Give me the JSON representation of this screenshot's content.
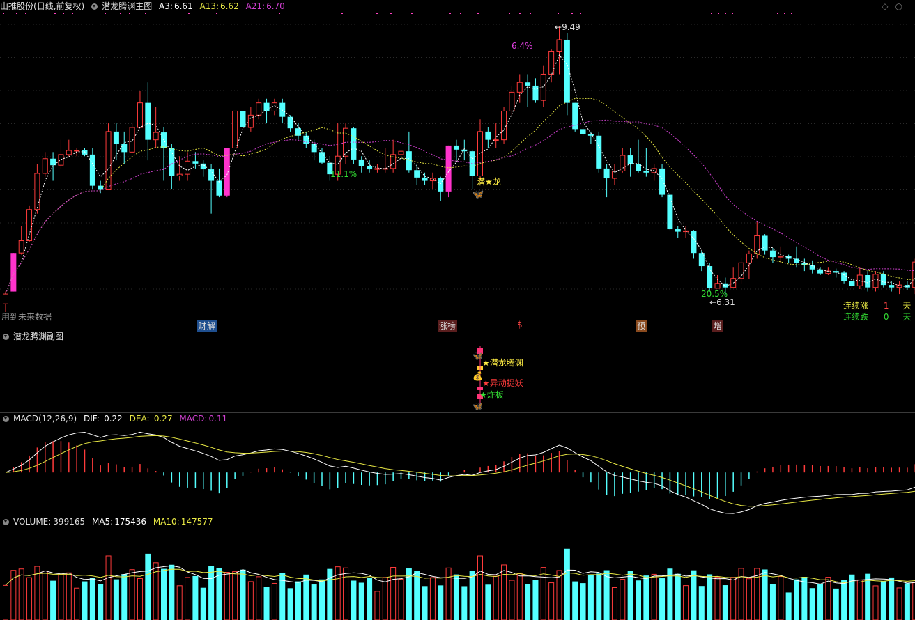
{
  "main": {
    "stock": "山推股份",
    "period": "(日线,前复权)",
    "indicator": "潜龙腾渊主图",
    "a3_label": "A3:",
    "a3": "6.61",
    "a13_label": "A13:",
    "a13": "6.62",
    "a21_label": "A21:",
    "a21": "6.70",
    "future_data": "用到未来数据",
    "high_label": "9.49",
    "low_label": "6.31",
    "pct_labels": [
      "6.4%",
      "11.1%",
      "20.5%"
    ],
    "signal": "潜★龙",
    "events": [
      "财",
      "解",
      "涨榜",
      "$",
      "预",
      "增"
    ],
    "streak_up_label": "连续涨",
    "streak_up": "1",
    "streak_up_unit": "天",
    "streak_down_label": "连续跌",
    "streak_down": "0",
    "streak_down_unit": "天"
  },
  "sub": {
    "title": "潜龙腾渊副图",
    "signals": [
      "★潜龙腾渊",
      "★异动捉妖",
      "★炸板"
    ]
  },
  "macd": {
    "title": "MACD(12,26,9)",
    "dif_label": "DIF:",
    "dif": "-0.22",
    "dea_label": "DEA:",
    "dea": "-0.27",
    "macd_label": "MACD:",
    "macd": "0.11"
  },
  "volume": {
    "title": "VOLUME:",
    "value": "399165",
    "ma5_label": "MA5:",
    "ma5": "175436",
    "ma10_label": "MA10:",
    "ma10": "147577"
  },
  "colors": {
    "up": "#ff3b3b",
    "down": "#54ffff",
    "ma_white": "#ffffff",
    "ma_yellow": "#e8e844",
    "ma_purple": "#d040d0",
    "limit_up": "#ff33cc"
  },
  "chart_data": {
    "type": "candlestick",
    "ylim": [
      6.0,
      9.6
    ],
    "candles": [
      [
        6.1,
        6.22,
        6.0,
        6.25
      ],
      [
        6.25,
        6.72,
        6.25,
        6.72
      ],
      [
        6.72,
        6.87,
        6.7,
        7.05
      ],
      [
        6.87,
        7.25,
        6.85,
        7.3
      ],
      [
        7.25,
        7.69,
        7.2,
        7.8
      ],
      [
        7.69,
        7.87,
        7.65,
        7.95
      ],
      [
        7.87,
        7.79,
        7.6,
        7.95
      ],
      [
        7.79,
        7.92,
        7.75,
        8.1
      ],
      [
        7.92,
        7.97,
        7.9,
        8.1
      ],
      [
        7.97,
        7.97,
        7.9,
        8.0
      ],
      [
        7.97,
        7.92,
        7.9,
        8.0
      ],
      [
        7.92,
        7.54,
        7.5,
        8.0
      ],
      [
        7.54,
        7.49,
        7.45,
        7.6
      ],
      [
        7.49,
        8.2,
        7.5,
        8.3
      ],
      [
        8.2,
        8.05,
        7.85,
        8.3
      ],
      [
        8.05,
        7.95,
        7.8,
        8.2
      ],
      [
        7.95,
        8.25,
        7.95,
        8.3
      ],
      [
        8.25,
        8.55,
        8.25,
        8.7
      ],
      [
        8.55,
        8.1,
        7.85,
        8.8
      ],
      [
        8.1,
        8.19,
        8.0,
        8.5
      ],
      [
        8.19,
        8.0,
        7.6,
        8.25
      ],
      [
        8.0,
        7.66,
        7.5,
        8.05
      ],
      [
        7.66,
        7.68,
        7.6,
        7.9
      ],
      [
        7.68,
        7.84,
        7.6,
        7.95
      ],
      [
        7.84,
        7.81,
        7.75,
        7.95
      ],
      [
        7.81,
        7.74,
        7.65,
        7.85
      ],
      [
        7.74,
        7.6,
        7.2,
        7.8
      ],
      [
        7.6,
        7.42,
        7.4,
        7.75
      ],
      [
        7.42,
        8.0,
        7.4,
        8.0
      ],
      [
        8.0,
        8.45,
        8.0,
        8.45
      ],
      [
        8.45,
        8.25,
        8.2,
        8.5
      ],
      [
        8.25,
        8.4,
        8.2,
        8.5
      ],
      [
        8.4,
        8.55,
        8.35,
        8.6
      ],
      [
        8.55,
        8.45,
        8.3,
        8.6
      ],
      [
        8.45,
        8.55,
        8.4,
        8.6
      ],
      [
        8.55,
        8.38,
        8.3,
        8.6
      ],
      [
        8.38,
        8.24,
        8.2,
        8.4
      ],
      [
        8.24,
        8.15,
        8.1,
        8.3
      ],
      [
        8.15,
        8.05,
        8.0,
        8.2
      ],
      [
        8.05,
        7.95,
        7.85,
        8.1
      ],
      [
        7.95,
        7.82,
        7.8,
        8.0
      ],
      [
        7.82,
        7.68,
        7.6,
        7.9
      ],
      [
        7.68,
        7.9,
        7.6,
        8.3
      ],
      [
        7.9,
        8.24,
        7.8,
        8.3
      ],
      [
        8.24,
        7.86,
        7.8,
        8.25
      ],
      [
        7.86,
        7.78,
        7.7,
        7.9
      ],
      [
        7.78,
        7.74,
        7.7,
        7.85
      ],
      [
        7.74,
        7.75,
        7.7,
        7.8
      ],
      [
        7.75,
        7.75,
        7.7,
        8.0
      ],
      [
        7.75,
        7.92,
        7.7,
        8.1
      ],
      [
        7.92,
        7.96,
        7.75,
        8.15
      ],
      [
        7.96,
        7.73,
        7.7,
        8.2
      ],
      [
        7.73,
        7.64,
        7.55,
        7.8
      ],
      [
        7.64,
        7.6,
        7.55,
        7.7
      ],
      [
        7.6,
        7.63,
        7.5,
        7.7
      ],
      [
        7.63,
        7.47,
        7.35,
        7.65
      ],
      [
        7.47,
        8.03,
        7.4,
        8.03
      ],
      [
        8.03,
        7.98,
        7.85,
        8.1
      ],
      [
        7.98,
        7.96,
        7.85,
        8.1
      ],
      [
        7.96,
        7.66,
        7.5,
        7.98
      ],
      [
        7.66,
        8.2,
        7.6,
        8.35
      ],
      [
        8.2,
        8.1,
        8.0,
        8.25
      ],
      [
        8.1,
        8.1,
        8.0,
        8.3
      ],
      [
        8.1,
        8.45,
        8.05,
        8.5
      ],
      [
        8.45,
        8.68,
        8.4,
        8.75
      ],
      [
        8.68,
        8.8,
        8.55,
        8.9
      ],
      [
        8.8,
        8.76,
        8.5,
        8.9
      ],
      [
        8.76,
        8.58,
        8.55,
        8.85
      ],
      [
        8.58,
        8.9,
        8.5,
        9.0
      ],
      [
        8.9,
        9.18,
        8.8,
        9.2
      ],
      [
        9.18,
        9.32,
        8.9,
        9.49
      ],
      [
        9.32,
        8.55,
        8.4,
        9.4
      ],
      [
        8.55,
        8.23,
        8.2,
        8.55
      ],
      [
        8.23,
        8.17,
        8.15,
        8.25
      ],
      [
        8.17,
        8.15,
        8.05,
        8.2
      ],
      [
        8.15,
        7.75,
        7.7,
        8.2
      ],
      [
        7.75,
        7.63,
        7.4,
        7.8
      ],
      [
        7.63,
        7.72,
        7.55,
        7.8
      ],
      [
        7.72,
        7.91,
        7.7,
        8.0
      ],
      [
        7.91,
        7.8,
        7.65,
        8.0
      ],
      [
        7.8,
        7.72,
        7.7,
        8.1
      ],
      [
        7.72,
        7.7,
        7.65,
        8.0
      ],
      [
        7.7,
        7.75,
        7.6,
        7.8
      ],
      [
        7.75,
        7.43,
        7.4,
        7.8
      ],
      [
        7.43,
        7.01,
        7.0,
        7.45
      ],
      [
        7.01,
        6.98,
        6.9,
        7.05
      ],
      [
        6.98,
        6.99,
        6.9,
        7.05
      ],
      [
        6.99,
        6.72,
        6.65,
        7.0
      ],
      [
        6.72,
        6.56,
        6.5,
        6.75
      ],
      [
        6.56,
        6.29,
        6.25,
        6.6
      ],
      [
        6.29,
        6.35,
        6.31,
        6.45
      ],
      [
        6.35,
        6.3,
        6.2,
        6.42
      ],
      [
        6.3,
        6.41,
        6.3,
        6.55
      ],
      [
        6.41,
        6.6,
        6.35,
        6.66
      ],
      [
        6.6,
        6.71,
        6.4,
        6.75
      ],
      [
        6.71,
        6.93,
        6.65,
        7.1
      ],
      [
        6.93,
        6.75,
        6.7,
        6.95
      ],
      [
        6.75,
        6.67,
        6.6,
        6.78
      ],
      [
        6.67,
        6.68,
        6.6,
        6.8
      ],
      [
        6.68,
        6.65,
        6.6,
        6.7
      ],
      [
        6.65,
        6.6,
        6.55,
        6.8
      ],
      [
        6.6,
        6.57,
        6.5,
        6.65
      ],
      [
        6.57,
        6.52,
        6.47,
        6.63
      ],
      [
        6.52,
        6.47,
        6.45,
        6.55
      ],
      [
        6.47,
        6.5,
        6.45,
        6.55
      ],
      [
        6.5,
        6.48,
        6.42,
        6.53
      ],
      [
        6.48,
        6.38,
        6.35,
        6.5
      ],
      [
        6.38,
        6.32,
        6.3,
        6.42
      ],
      [
        6.32,
        6.45,
        6.28,
        6.55
      ],
      [
        6.45,
        6.3,
        6.25,
        6.5
      ],
      [
        6.3,
        6.46,
        6.25,
        6.5
      ],
      [
        6.46,
        6.33,
        6.3,
        6.5
      ],
      [
        6.33,
        6.3,
        6.25,
        6.38
      ],
      [
        6.3,
        6.33,
        6.22,
        6.38
      ],
      [
        6.33,
        6.3,
        6.27,
        6.38
      ],
      [
        6.3,
        6.61,
        6.22,
        6.65
      ]
    ],
    "limit_up_bars": [
      1,
      28,
      56
    ],
    "macd_range": [
      -0.5,
      0.6
    ],
    "volume_max": 1000000
  }
}
